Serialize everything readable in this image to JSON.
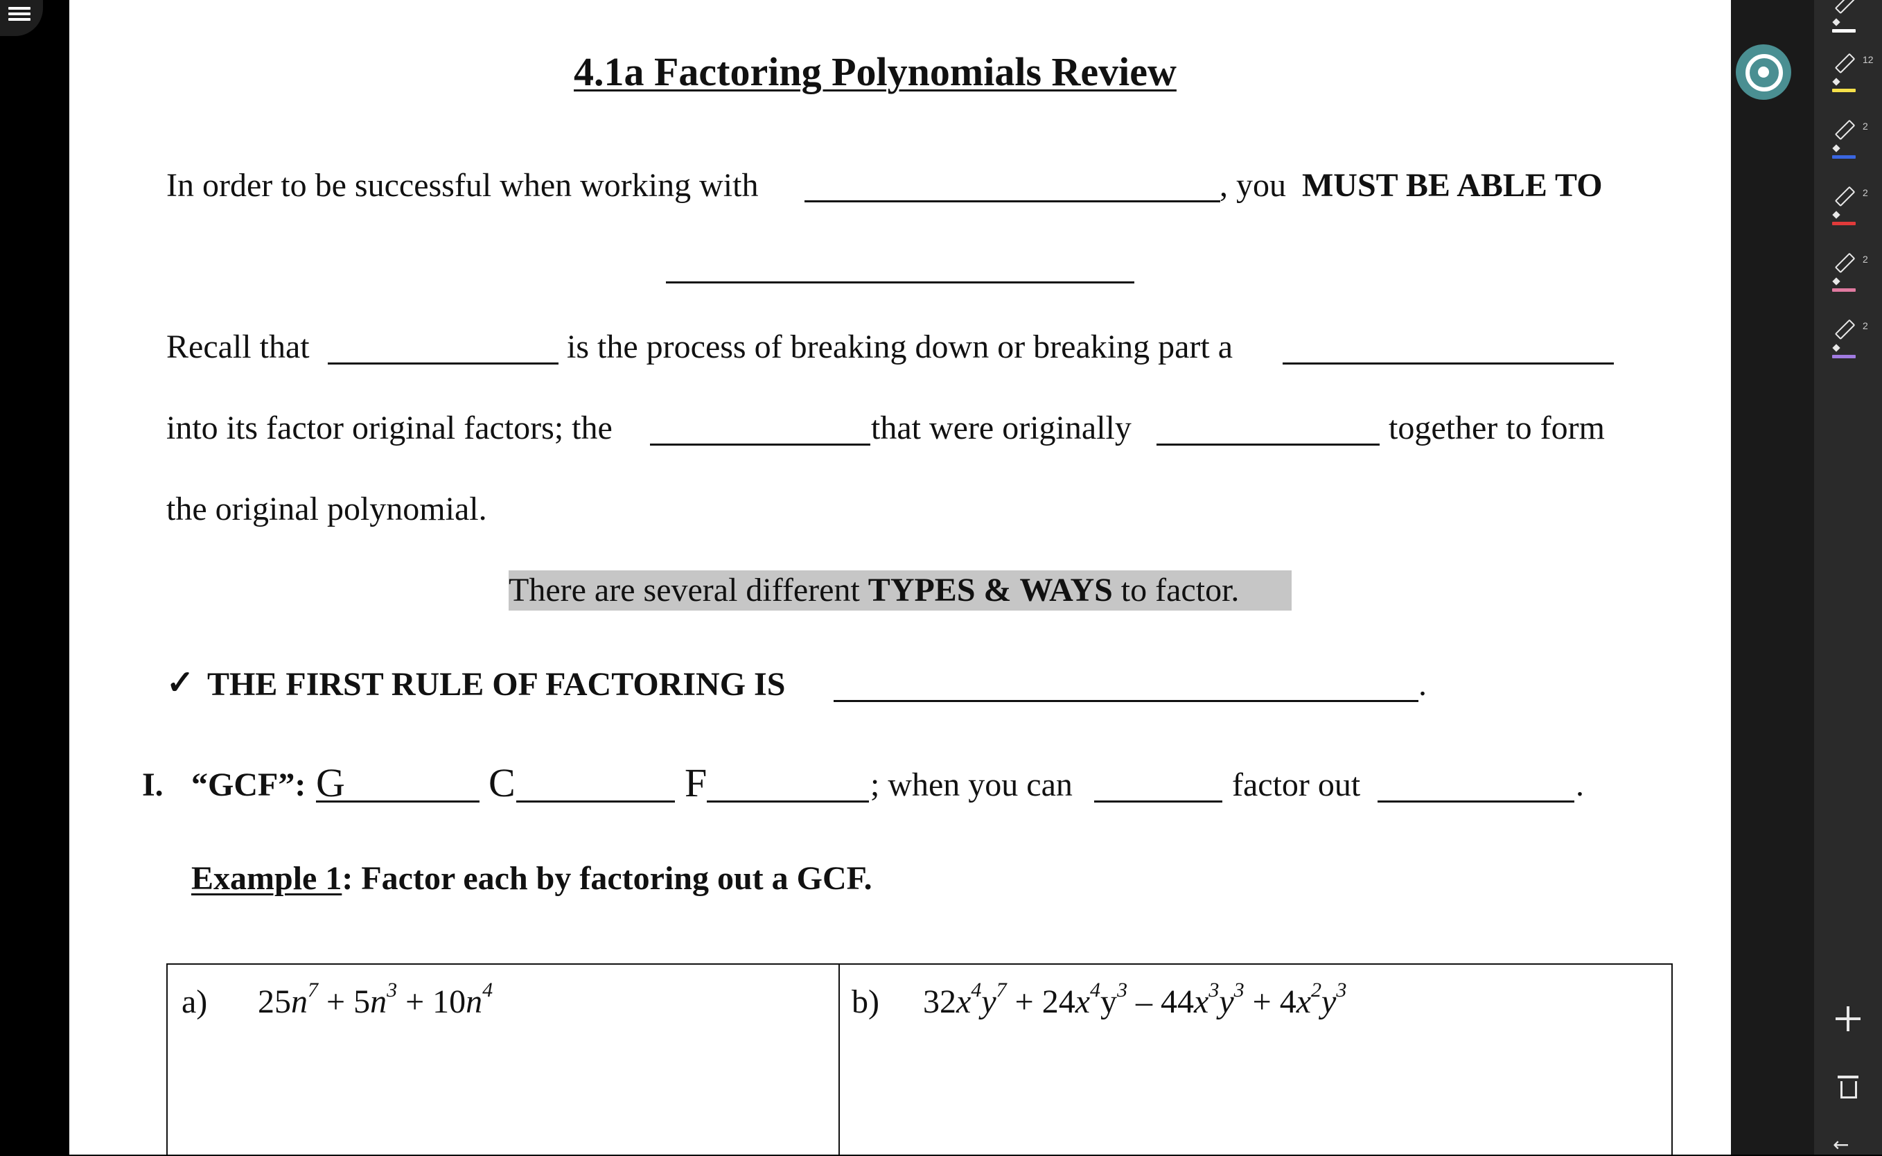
{
  "document": {
    "title": "4.1a Factoring Polynomials Review",
    "line1_start": "In order to be successful when working with",
    "line1_mid": ", you",
    "line1_bold": "MUST BE ABLE TO",
    "recall_1": "Recall that",
    "recall_2": "is the process of breaking down or breaking part a",
    "into_1": "into its factor original factors; the",
    "into_2": "that were originally",
    "into_3": "together to form",
    "original_poly": "the original polynomial.",
    "types_1": "There are several different",
    "types_bold_1": "TYPES",
    "types_amp": "&",
    "types_bold_2": "WAYS",
    "types_end": "to factor.",
    "first_rule_check": "✓",
    "first_rule": "THE FIRST RULE OF FACTORING IS",
    "period": ".",
    "gcf_numeral": "I.",
    "gcf_label": "“GCF”:",
    "gcf_g": "G",
    "gcf_c": "C",
    "gcf_f": "F",
    "gcf_when": "; when you can",
    "gcf_factor_out": "factor out",
    "example_label": "Example 1",
    "example_text": ": Factor each by factoring out a GCF.",
    "problem_a_label": "a)",
    "problem_b_label": "b)"
  },
  "toolbar": {
    "pens": [
      {
        "name": "pen-white",
        "color": "#ffffff",
        "count": ""
      },
      {
        "name": "pen-yellow",
        "color": "#f5e04a",
        "count": "12"
      },
      {
        "name": "pen-blue",
        "color": "#3a66e0",
        "count": "2"
      },
      {
        "name": "pen-red",
        "color": "#e03a3a",
        "count": "2"
      },
      {
        "name": "pen-pink",
        "color": "#e07aa0",
        "count": "2"
      },
      {
        "name": "pen-purple",
        "color": "#a07ae0",
        "count": "2"
      }
    ],
    "back_glyph": "←"
  },
  "colors": {
    "settings_button": "#4a8f92",
    "highlight": "#c6c6c6"
  }
}
